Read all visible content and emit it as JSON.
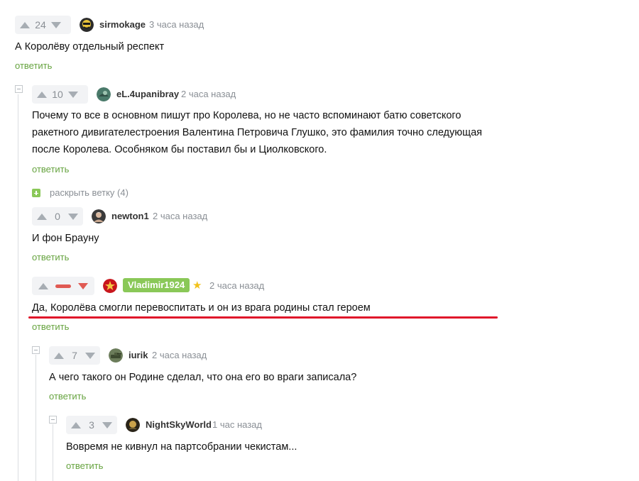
{
  "comments": [
    {
      "votes": "24",
      "author": "sirmokage",
      "time": "3 часа назад",
      "text": [
        "А Королёву отдельный респект"
      ],
      "reply": "ответить"
    },
    {
      "votes": "10",
      "author": "eL.4upanibray",
      "time": "2 часа назад",
      "text": [
        "Почему то все в основном пишут про Королева, но не часто вспоминают батю советского",
        "ракетного дивигателестроения Валентина Петровича Глушко, это фамилия точно следующая",
        "после Королева. Особняком бы поставил бы и Циолковского."
      ],
      "reply": "ответить",
      "expand_label": "раскрыть ветку (4)"
    },
    {
      "votes": "0",
      "author": "newton1",
      "time": "2 часа назад",
      "text": [
        "И фон Брауну"
      ],
      "reply": "ответить"
    },
    {
      "votes": "",
      "author": "Vladimir1924",
      "time": "2 часа назад",
      "text": [
        "Да, Королёва смогли перевоспитать и он из врага родины стал героем"
      ],
      "reply": "ответить"
    },
    {
      "votes": "7",
      "author": "iurik",
      "time": "2 часа назад",
      "text": [
        "А чего такого он Родине сделал, что она его во враги записала?"
      ],
      "reply": "ответить"
    },
    {
      "votes": "3",
      "author": "NightSkyWorld",
      "time": "1 час назад",
      "text": [
        "Вовремя не кивнул на партсобрании чекистам..."
      ],
      "reply": "ответить"
    }
  ],
  "colors": {
    "reply": "#66a33f",
    "author_badge": "#8ac858",
    "negative": "#e05a53",
    "highlight_underline": "#e0152a"
  },
  "icons": {
    "upvote": "triangle-up",
    "downvote": "triangle-down",
    "collapse": "minus-square",
    "expand": "plus-square",
    "star": "star"
  }
}
